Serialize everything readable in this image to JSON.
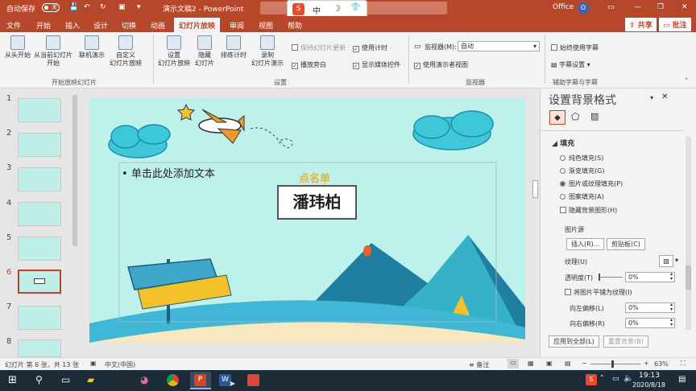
{
  "titlebar": {
    "autosave": "自动保存",
    "autosave_state": "关",
    "doc_title": "演示文稿2 - PowerPoint",
    "user": "Office",
    "user_initial": "O",
    "ime": [
      "S",
      "中",
      "☽",
      "👕"
    ]
  },
  "tabs": [
    "文件",
    "开始",
    "插入",
    "设计",
    "切换",
    "动画",
    "幻灯片放映",
    "审阅",
    "视图",
    "帮助"
  ],
  "share": "共享",
  "comment": "批注",
  "ribbon": {
    "start_group": {
      "label": "开始放映幻灯片",
      "from_begin": "从头开始",
      "from_current": "从当前幻灯片\n开始",
      "online": "联机演示",
      "custom": "自定义\n幻灯片放映"
    },
    "setup_group": {
      "label": "设置",
      "setup": "设置\n幻灯片放映",
      "hide": "隐藏\n幻灯片",
      "rehearse": "排练计时",
      "record": "录制\n幻灯片演示",
      "keep_updated": "保持幻灯片更新",
      "play_narr": "播放旁白",
      "use_timing": "使用计时",
      "show_media": "显示媒体控件"
    },
    "monitor_group": {
      "label": "监视器",
      "monitor_label": "监视器(M):",
      "monitor_value": "自动",
      "presenter_view": "使用演示者视图"
    },
    "caption_group": {
      "label": "辅助字幕与字幕",
      "always_sub": "始终使用字幕",
      "sub_settings": "字幕设置"
    }
  },
  "thumbs": {
    "numbers": [
      "1",
      "2",
      "3",
      "4",
      "5",
      "6",
      "7",
      "8"
    ],
    "selected": "6"
  },
  "slide": {
    "bullet": "单击此处添加文本",
    "roll_call": "点名单",
    "name": "潘玮柏"
  },
  "pane": {
    "title": "设置背景格式",
    "section": "填充",
    "options": [
      "纯色填充(S)",
      "渐变填充(G)",
      "图片或纹理填充(P)",
      "图案填充(A)"
    ],
    "selected_option": "图片或纹理填充(P)",
    "hide_bg": "隐藏背景图形(H)",
    "source": "图片源",
    "insert_btn": "插入(R)...",
    "clipboard_btn": "剪贴板(C)",
    "texture": "纹理(U)",
    "transparency": "透明度(T)",
    "transparency_val": "0%",
    "tile": "将图片平铺为纹理(I)",
    "offset_left": "向左偏移(L)",
    "offset_left_val": "0%",
    "offset_right": "向右偏移(R)",
    "offset_right_val": "0%",
    "apply_all": "应用到全部(L)",
    "reset": "重置背景(B)"
  },
  "status": {
    "slide_info": "幻灯片 第 6 张，共 13 张",
    "lang": "中文(中国)",
    "notes": "备注",
    "zoom": "63%"
  },
  "taskbar": {
    "time": "19:13",
    "date": "2020/8/18"
  },
  "colors": {
    "accent": "#b7472a",
    "slide_bg": "#bff1ec",
    "name_border": "#555555",
    "roll_call": "#e8b23a"
  }
}
